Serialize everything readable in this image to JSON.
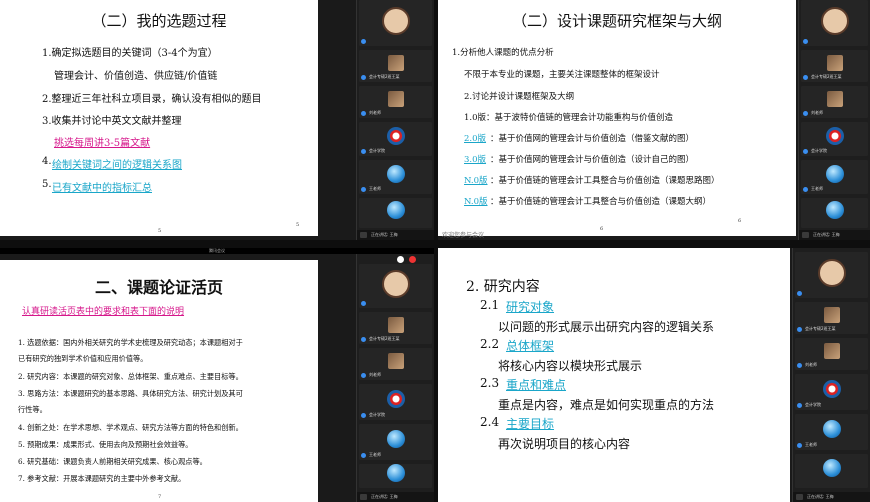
{
  "panel1": {
    "title": "（二）我的选题过程",
    "items": [
      "1.确定拟选题目的关键词（3-4个为宜）",
      "管理会计、价值创造、供应链/价值链",
      "2.整理近三年社科立项目录，确认没有相似的题目",
      "3.收集并讨论中英文文献并整理",
      "挑选每周讲3-5篇文献",
      "4.",
      "绘制关键词之间的逻辑关系图",
      "5.",
      "已有文献中的指标汇总"
    ],
    "page_small": "5",
    "page_num": "5"
  },
  "panel2": {
    "title": "（二）设计课题研究框架与大纲",
    "items": [
      "1.分析他人课题的优点分析",
      "不限于本专业的课题，主要关注课题整体的框架设计",
      "2.讨论并设计课题框架及大纲",
      "1.0版：基于波特价值链的管理会计功能重构与价值创造",
      "2.0版",
      "：基于价值网的管理会计与价值创造（借鉴文献的图）",
      "3.0版",
      "：基于价值网的管理会计与价值创造（设计自己的图）",
      "N.0版",
      "：基于价值链的管理会计工具整合与价值创造（课题思路图）",
      "N.0版",
      "：基于价值链的管理会计工具整合与价值创造（课题大纲）"
    ],
    "page_small": "6",
    "page_num": "6",
    "watermark": "欢迎您参与会议"
  },
  "panel3": {
    "topbar": "腾讯会议",
    "title": "二、课题论证活页",
    "subtitle": "认真研读活页表中的要求和表下面的说明",
    "items": [
      "1. 选题依据：国内外相关研究的学术史梳理及研究动态；本课题相对于",
      "已有研究的独到学术价值和应用价值等。",
      "2. 研究内容：本课题的研究对象、总体框架、重点难点、主要目标等。",
      "3. 思路方法：本课题研究的基本思路、具体研究方法、研究计划及其可",
      "行性等。",
      "4. 创新之处：在学术思想、学术观点、研究方法等方面的特色和创新。",
      "5. 预期成果：成果形式、使用去向及预期社会效益等。",
      "6. 研究基础：课题负责人前期相关研究成果、核心观点等。",
      "7. 参考文献：开展本课题研究的主要中外参考文献。"
    ],
    "page_small": "7"
  },
  "panel4": {
    "heading": "2. 研究内容",
    "sections": [
      {
        "num": "2.1",
        "link": "研究对象",
        "desc": "以问题的形式展示出研究内容的逻辑关系"
      },
      {
        "num": "2.2",
        "link": "总体框架",
        "desc": "将核心内容以模块形式展示"
      },
      {
        "num": "2.3",
        "link": "重点和难点",
        "desc": "重点是内容，难点是如何实现重点的方法"
      },
      {
        "num": "2.4",
        "link": "主要目标",
        "desc": "再次说明项目的核心内容"
      }
    ]
  },
  "sidebar": {
    "participants": [
      "会计专硕2班王某",
      "刘老师",
      "会计学院",
      "王老师"
    ],
    "control_label": "正在讲话: 王梅"
  }
}
